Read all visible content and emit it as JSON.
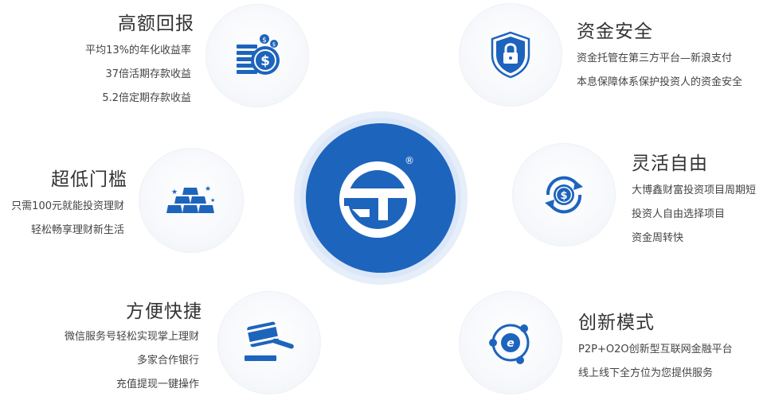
{
  "accent_color": "#1d64bd",
  "features": {
    "high_return": {
      "title": "高额回报",
      "icon": "coins-icon",
      "lines": [
        "平均13%的年化收益率",
        "37倍活期存款收益",
        "5.2倍定期存款收益"
      ]
    },
    "low_threshold": {
      "title": "超低门槛",
      "icon": "gold-bars-icon",
      "lines": [
        "只需100元就能投资理财",
        "轻松畅享理财新生活"
      ]
    },
    "convenient": {
      "title": "方便快捷",
      "icon": "gavel-icon",
      "lines": [
        "微信服务号轻松实现掌上理财",
        "多家合作银行",
        "充值提现一键操作"
      ]
    },
    "fund_security": {
      "title": "资金安全",
      "icon": "shield-lock-icon",
      "lines": [
        "资金托管在第三方平台—新浪支付",
        "本息保障体系保护投资人的资金安全"
      ]
    },
    "flexible": {
      "title": "灵活自由",
      "icon": "cycle-dollar-icon",
      "lines": [
        "大博鑫财富投资项目周期短",
        "投资人自由选择项目",
        "资金周转快"
      ]
    },
    "innovative": {
      "title": "创新模式",
      "icon": "network-ie-icon",
      "lines": [
        "P2P+O2O创新型互联网金融平台",
        "线上线下全方位为您提供服务"
      ]
    }
  },
  "center_logo": {
    "icon": "brand-logo-icon",
    "registered": "®"
  }
}
